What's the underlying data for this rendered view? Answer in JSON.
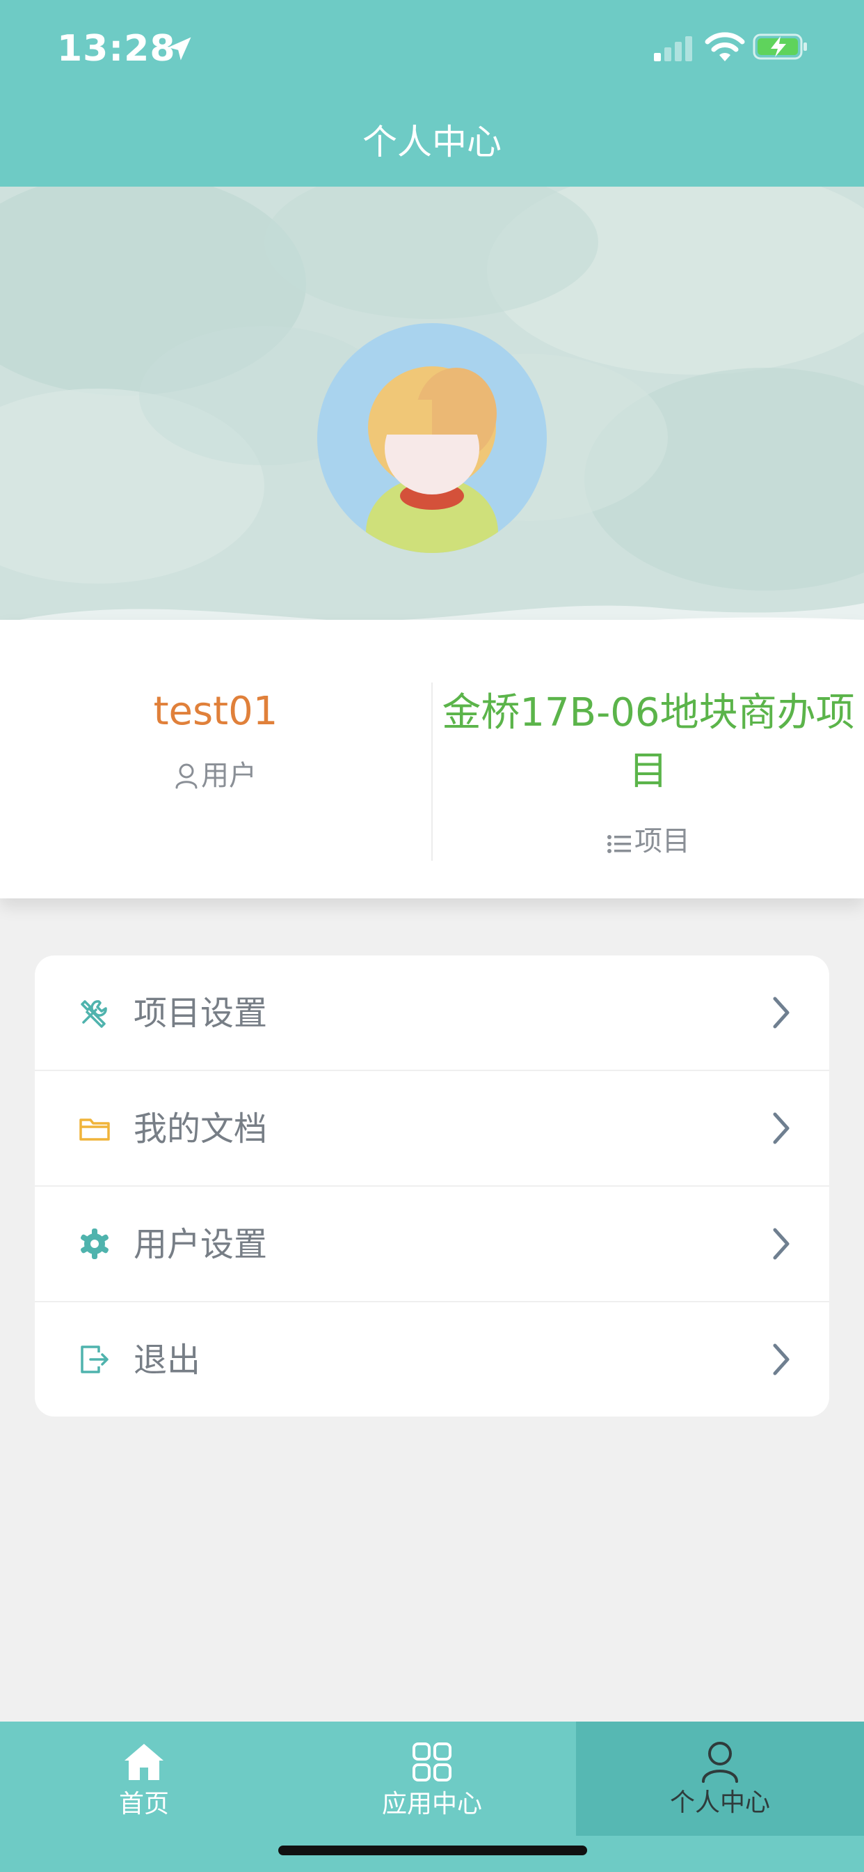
{
  "status_bar": {
    "time": "13:28"
  },
  "nav": {
    "title": "个人中心"
  },
  "profile": {
    "username": "test01",
    "user_label": "用户",
    "project_name": "金桥17B-06地块商办项目",
    "project_label": "项目"
  },
  "menu": {
    "items": [
      {
        "label": "项目设置",
        "icon": "tools-icon"
      },
      {
        "label": "我的文档",
        "icon": "folder-icon"
      },
      {
        "label": "用户设置",
        "icon": "gear-icon"
      },
      {
        "label": "退出",
        "icon": "logout-icon"
      }
    ]
  },
  "tabs": [
    {
      "label": "首页",
      "icon": "home-icon"
    },
    {
      "label": "应用中心",
      "icon": "grid-icon"
    },
    {
      "label": "个人中心",
      "icon": "person-icon",
      "active": true
    }
  ],
  "colors": {
    "primary": "#6ecbc5",
    "active_tab": "#56b8b3",
    "username": "#e0803a",
    "project": "#5bb44a"
  }
}
